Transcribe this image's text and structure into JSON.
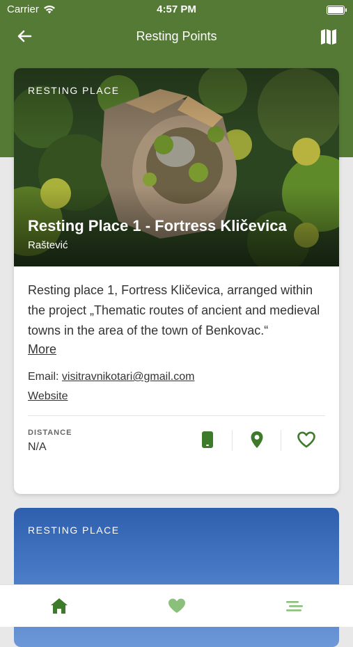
{
  "status_bar": {
    "carrier": "Carrier",
    "time": "4:57 PM"
  },
  "nav": {
    "title": "Resting Points"
  },
  "cards": [
    {
      "category": "RESTING PLACE",
      "title": "Resting Place 1 - Fortress Kličevica",
      "subtitle": "Raštević",
      "description": "Resting place 1, Fortress Kličevica, arranged within the project „Thematic routes of ancient and medieval towns in the area of the town of Benkovac.“",
      "more_label": "More",
      "email_label": "Email:",
      "email": "visitravnikotari@gmail.com",
      "website_label": "Website",
      "distance_label": "DISTANCE",
      "distance_value": "N/A"
    },
    {
      "category": "RESTING PLACE"
    }
  ],
  "colors": {
    "brand_green": "#547a35",
    "icon_green": "#3d7a2a"
  },
  "icons": {
    "back": "arrow-left-icon",
    "map": "map-icon",
    "phone": "phone-icon",
    "location": "location-pin-icon",
    "favorite": "heart-outline-icon",
    "tab_home": "home-icon",
    "tab_favorites": "heart-icon",
    "tab_menu": "menu-icon"
  }
}
